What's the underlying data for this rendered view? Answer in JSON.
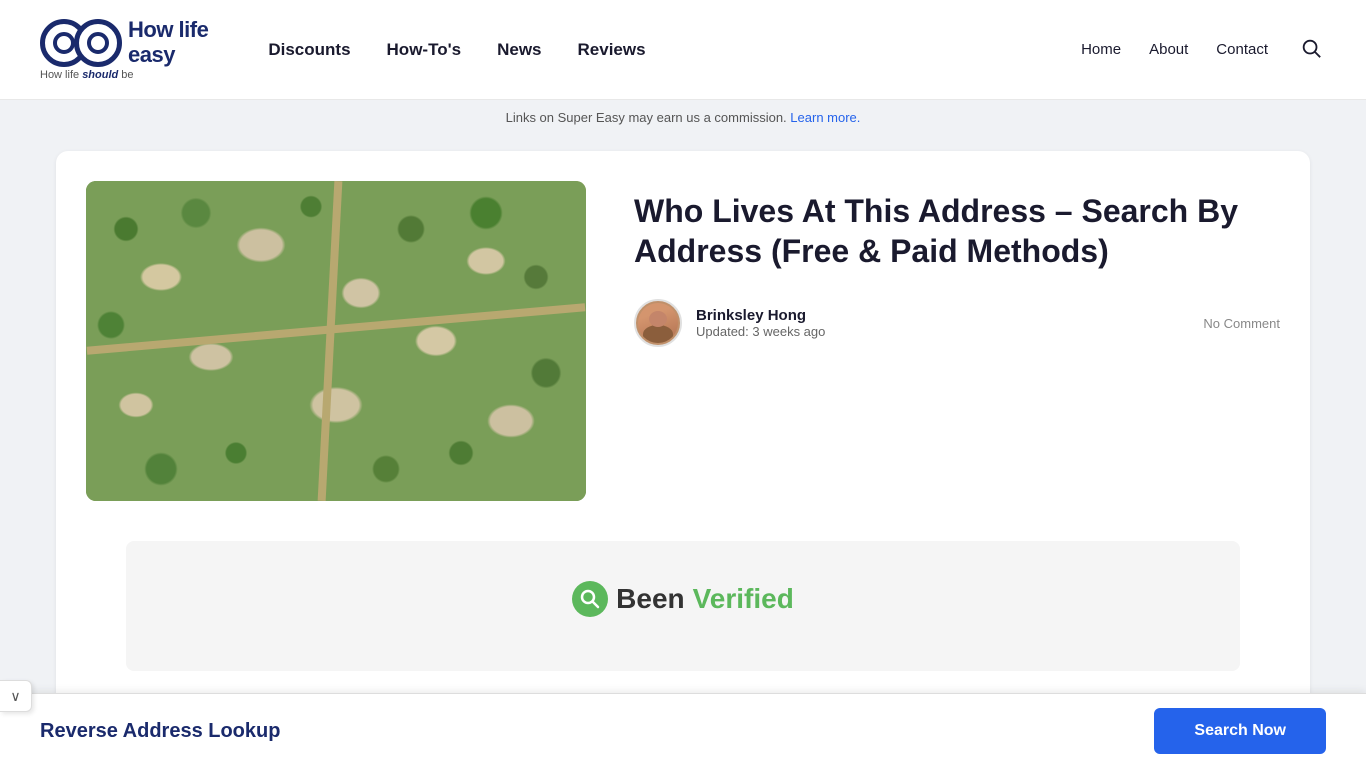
{
  "header": {
    "logo": {
      "tagline_before": "How life ",
      "tagline_highlight": "should",
      "tagline_after": " be"
    },
    "main_nav": [
      {
        "label": "Discounts",
        "href": "#"
      },
      {
        "label": "How-To's",
        "href": "#"
      },
      {
        "label": "News",
        "href": "#"
      },
      {
        "label": "Reviews",
        "href": "#"
      }
    ],
    "right_nav": [
      {
        "label": "Home",
        "href": "#"
      },
      {
        "label": "About",
        "href": "#"
      },
      {
        "label": "Contact",
        "href": "#"
      }
    ],
    "search_label": "Search"
  },
  "commission_bar": {
    "text": "Links on Super Easy may earn us a commission.",
    "learn_more": "Learn more."
  },
  "article": {
    "title": "Who Lives At This Address – Search By Address (Free & Paid Methods)",
    "author_name": "Brinksley Hong",
    "updated": "Updated: 3 weeks ago",
    "no_comment": "No Comment"
  },
  "been_verified": {
    "icon_text": "🔍",
    "text_been": "Been",
    "text_verified": "Verified"
  },
  "bottom_bar": {
    "title": "Reverse Address Lookup",
    "search_btn": "Search Now"
  },
  "collapse_btn_label": "∨"
}
